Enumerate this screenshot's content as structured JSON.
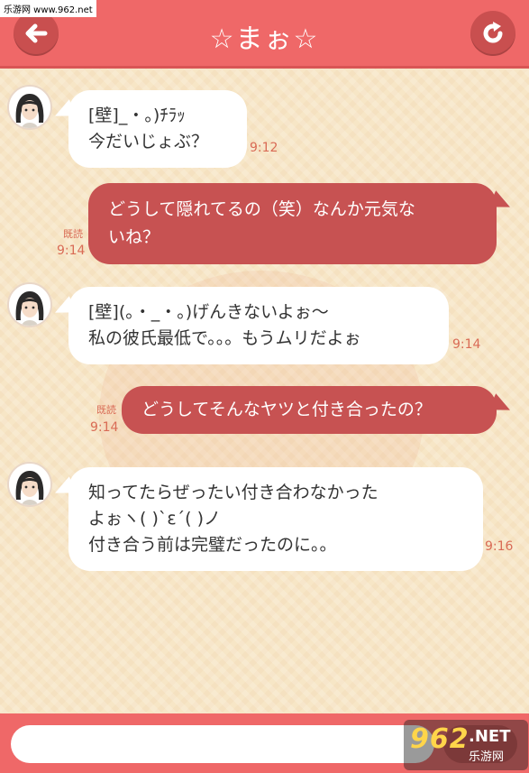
{
  "watermark": {
    "top_text": "乐游网 www.962.net",
    "logo_num": "962",
    "logo_net": ".NET",
    "logo_cn": "乐游网"
  },
  "header": {
    "title": "☆まぉ☆",
    "back_icon": "back-arrow-icon",
    "reload_icon": "reload-icon"
  },
  "messages": [
    {
      "dir": "in",
      "lines": [
        "[壁]_・。)ﾁﾗｯ",
        "今だいじょぶ？"
      ],
      "time": "9:12"
    },
    {
      "dir": "out",
      "lines": [
        "どうして隠れてるの（笑）なんか元気な",
        "いね？"
      ],
      "read": "既読",
      "time": "9:14"
    },
    {
      "dir": "in",
      "lines": [
        "[壁](。・_・。)げんきないよぉ～",
        "私の彼氏最低で。。。もうムリだよぉ"
      ],
      "time": "9:14"
    },
    {
      "dir": "out",
      "lines": [
        "どうしてそんなヤツと付き合ったの？"
      ],
      "read": "既読",
      "time": "9:14"
    },
    {
      "dir": "in",
      "lines": [
        "知ってたらぜったい付き合わなかった",
        "よぉヽ( )`ε´( )ノ",
        "付き合う前は完璧だったのに。。"
      ],
      "time": "9:16"
    }
  ],
  "composer": {
    "input_value": "",
    "placeholder": ""
  },
  "colors": {
    "accent": "#ef6868",
    "out_bubble": "#c75252",
    "timestamp": "#d96b55"
  }
}
